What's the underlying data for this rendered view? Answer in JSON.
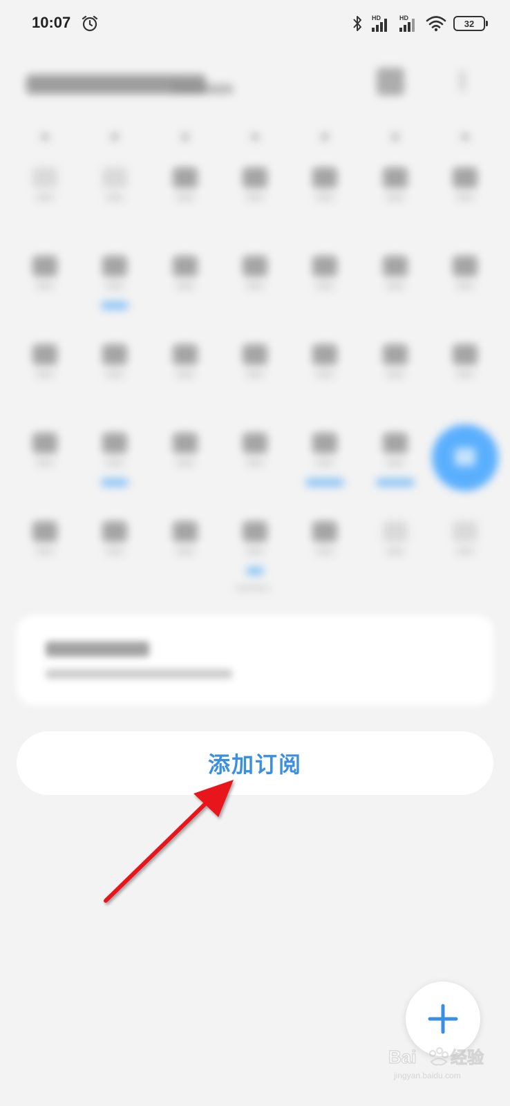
{
  "status_bar": {
    "time": "10:07",
    "network_label_1": "HD",
    "network_label_2": "HD",
    "battery": "32"
  },
  "subscription": {
    "add_label": "添加订阅"
  },
  "fab": {
    "icon": "plus-icon"
  },
  "colors": {
    "accent": "#3b8fe0",
    "today_highlight": "#4aa8ff",
    "annotation_arrow": "#e8141c",
    "background": "#f3f3f3"
  },
  "watermark": {
    "brand": "Baidu",
    "brand_cn": "经验",
    "url": "jingyan.baidu.com"
  }
}
